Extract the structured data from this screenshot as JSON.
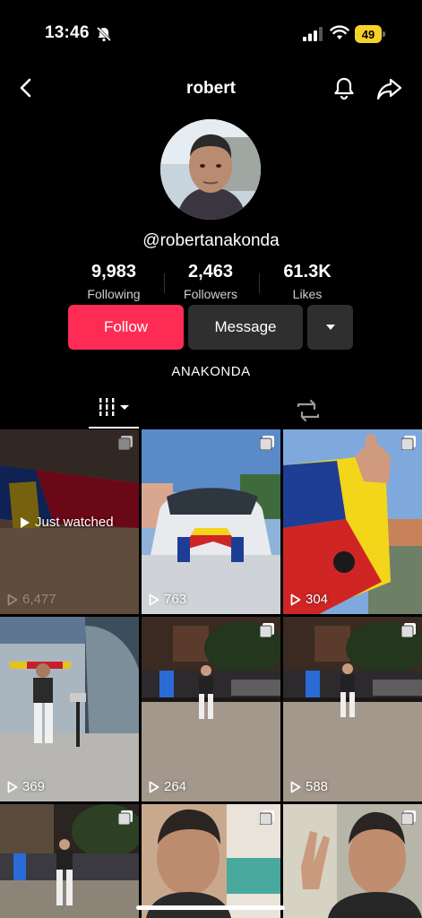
{
  "status": {
    "time": "13:46",
    "battery": "49"
  },
  "header": {
    "title": "robert"
  },
  "profile": {
    "username": "@robertanakonda",
    "stats": [
      {
        "value": "9,983",
        "label": "Following"
      },
      {
        "value": "2,463",
        "label": "Followers"
      },
      {
        "value": "61.3K",
        "label": "Likes"
      }
    ],
    "follow_label": "Follow",
    "message_label": "Message",
    "bio": "ANAKONDA"
  },
  "grid": {
    "just_watched": "Just watched",
    "views": [
      "6,477",
      "763",
      "304",
      "369",
      "264",
      "588"
    ]
  },
  "colors": {
    "accent": "#fe2c55",
    "battery": "#f6d12a"
  }
}
